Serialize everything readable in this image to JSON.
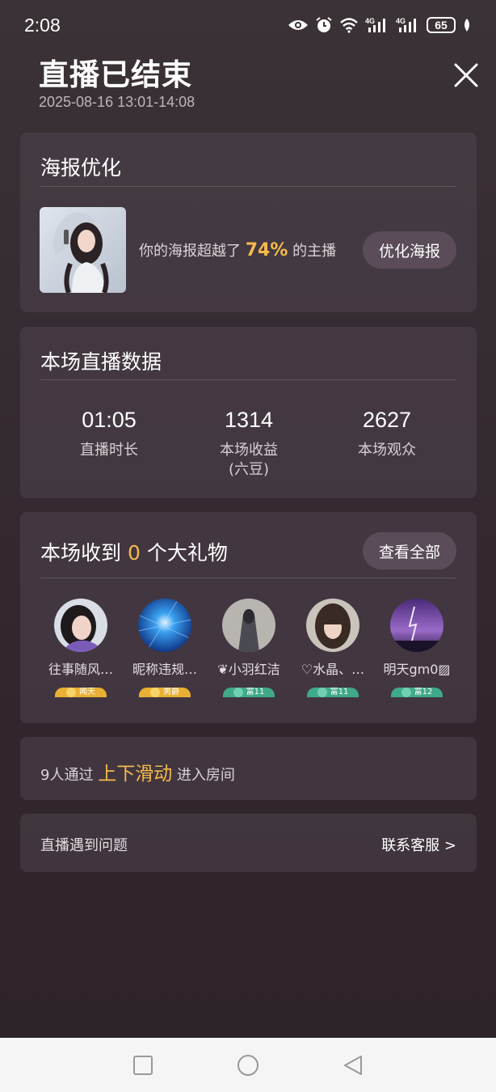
{
  "status_bar": {
    "time": "2:08",
    "battery": "65",
    "icons": [
      "eye-icon",
      "alarm-icon",
      "wifi-icon",
      "signal-4g-icon",
      "signal-4g-icon",
      "battery-icon",
      "leaf-icon"
    ]
  },
  "header": {
    "title": "直播已结束",
    "time_range": "2025-08-16 13:01-14:08",
    "close_icon": "close-icon"
  },
  "poster_card": {
    "title": "海报优化",
    "text_before": "你的海报超越了",
    "percent": "74%",
    "text_after": "的主播",
    "button": "优化海报"
  },
  "stats_card": {
    "title": "本场直播数据",
    "stats": [
      {
        "value": "01:05",
        "label": "直播时长"
      },
      {
        "value": "1314",
        "label": "本场收益\n(六豆)"
      },
      {
        "value": "2627",
        "label": "本场观众"
      }
    ]
  },
  "gifts_card": {
    "title_before": "本场收到",
    "count": "0",
    "title_after": "个大礼物",
    "view_all": "查看全部",
    "givers": [
      {
        "name": "往事随风…",
        "badge_text": "闻天",
        "badge_color": "#e9b033"
      },
      {
        "name": "昵称违规…",
        "badge_text": "男爵",
        "badge_color": "#e9b033"
      },
      {
        "name": "❦小羽红洁",
        "badge_text": "富11",
        "badge_color": "#3fa98a"
      },
      {
        "name": "♡水晶、…",
        "badge_text": "富11",
        "badge_color": "#3fa98a"
      },
      {
        "name": "明天gm0▨",
        "badge_text": "富12",
        "badge_color": "#3fa98a"
      }
    ]
  },
  "enter_card": {
    "prefix": "9人通过",
    "highlight": "上下滑动",
    "suffix": "进入房间"
  },
  "help_card": {
    "text": "直播遇到问题",
    "link": "联系客服 >"
  },
  "nav_bar": {
    "icons": [
      "square-icon",
      "circle-icon",
      "back-triangle-icon"
    ]
  },
  "colors": {
    "accent": "#f5b94d",
    "card_bg": "#4e444e",
    "button_bg": "#5a4c58"
  }
}
